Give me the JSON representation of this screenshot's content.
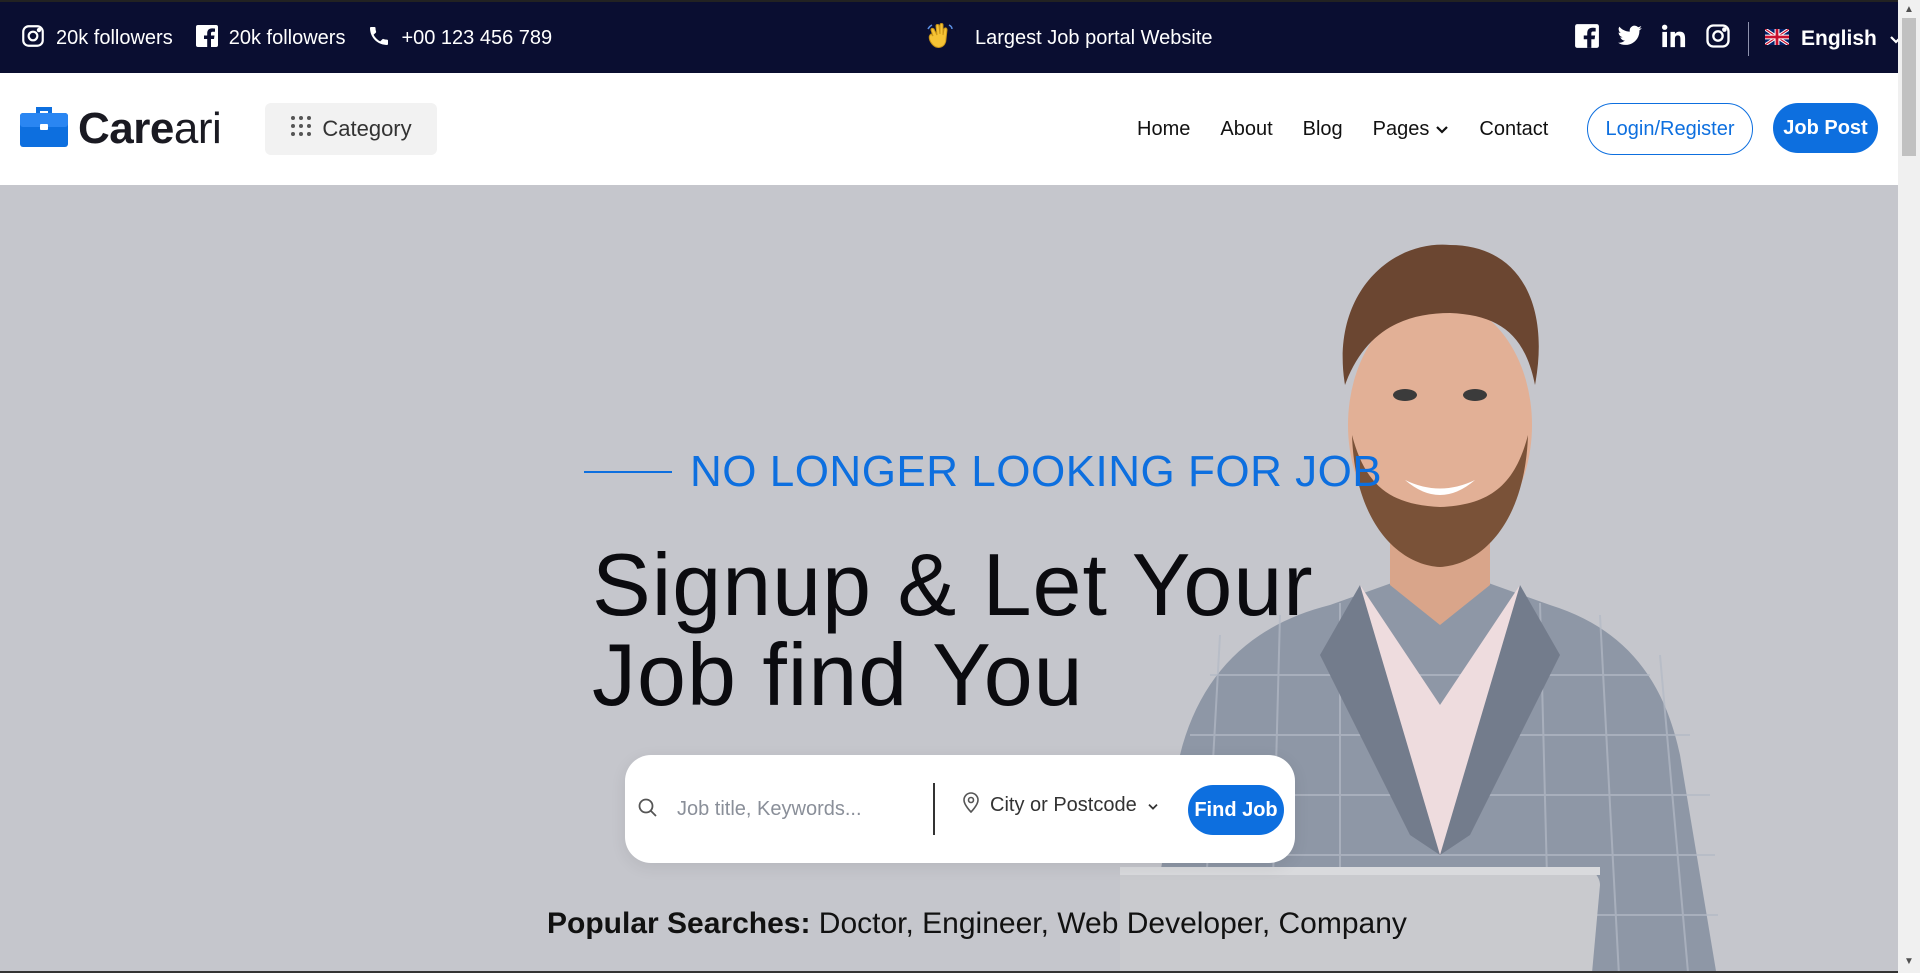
{
  "topbar": {
    "instagram_followers": "20k followers",
    "facebook_followers": "20k followers",
    "phone": "+00 123 456 789",
    "tagline": "Largest Job portal Website",
    "language": "English"
  },
  "header": {
    "logo_bold": "Care",
    "logo_light": "ari",
    "category_label": "Category",
    "nav": {
      "home": "Home",
      "about": "About",
      "blog": "Blog",
      "pages": "Pages",
      "contact": "Contact"
    },
    "login_label": "Login/Register",
    "jobpost_label": "Job Post"
  },
  "hero": {
    "eyebrow": "NO LONGER LOOKING FOR JOB",
    "headline_line1": "Signup & Let Your",
    "headline_line2": "Job find You",
    "search_placeholder": "Job title, Keywords...",
    "location_label": "City or Postcode",
    "find_label": "Find Job",
    "popular_label": "Popular Searches:",
    "popular_terms": "Doctor, Engineer, Web Developer, Company"
  },
  "colors": {
    "accent": "#0d6fdf",
    "topbar_bg": "#0a0e31",
    "hero_bg": "#c5c6cc"
  },
  "icons": {
    "instagram": "instagram-icon",
    "facebook": "facebook-icon",
    "phone": "phone-icon",
    "wave": "waving-hand-icon",
    "twitter": "twitter-icon",
    "linkedin": "linkedin-icon",
    "flag": "uk-flag-icon",
    "grid": "grid-icon",
    "search": "search-icon",
    "location": "location-pin-icon"
  }
}
